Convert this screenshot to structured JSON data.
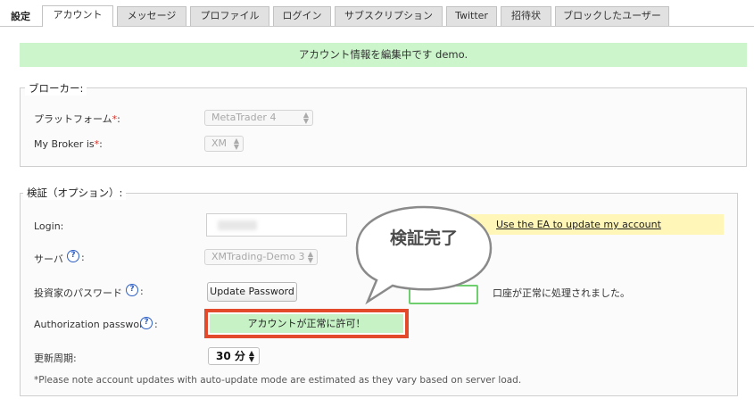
{
  "tabs": {
    "title": "設定",
    "items": [
      {
        "label": "アカウント",
        "active": true
      },
      {
        "label": "メッセージ"
      },
      {
        "label": "プロファイル"
      },
      {
        "label": "ログイン"
      },
      {
        "label": "サブスクリプション"
      },
      {
        "label": "Twitter"
      },
      {
        "label": "招待状"
      },
      {
        "label": "ブロックしたユーザー"
      }
    ]
  },
  "banner": "アカウント情報を編集中です demo.",
  "broker": {
    "legend": "ブローカー:",
    "platform_label": "プラットフォーム",
    "platform_value": "MetaTrader 4",
    "mybroker_label": "My Broker is",
    "mybroker_value": "XM",
    "required_mark": "*",
    "colon": ":"
  },
  "verify": {
    "legend": "検証（オプション）:",
    "login_label": "Login:",
    "server_label": "サーバ",
    "server_value": "XMTrading-Demo 3",
    "investor_label": "投資家のパスワード",
    "update_password": "Update Password",
    "auth_label": "Authorization password",
    "auth_status": "アカウントが正常に許可！",
    "refresh_label": "更新周期:",
    "refresh_value": "30 分",
    "processed_text": "口座が正常に処理されました。",
    "ea_link": "Use the EA to update my account",
    "bubble": "検証完了",
    "note": "*Please note account updates with auto-update mode are estimated as they vary based on server load.",
    "help": "?",
    "colon": ":"
  }
}
